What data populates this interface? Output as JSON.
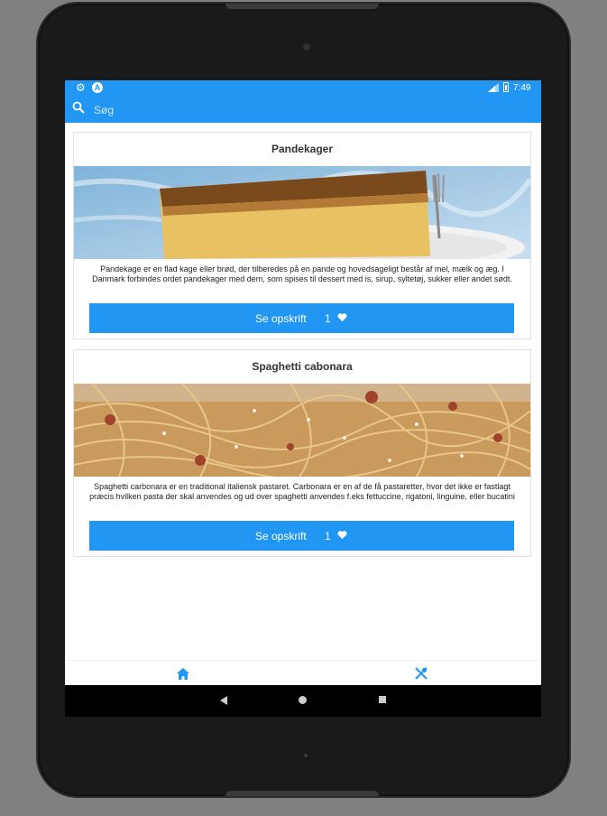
{
  "status_bar": {
    "time": "7:49"
  },
  "search": {
    "placeholder": "Søg",
    "value": ""
  },
  "recipes": [
    {
      "title": "Pandekager",
      "description": "Pandekage er en flad kage eller brød, der tilberedes på en pande og hovedsageligt består af mel, mælk og æg. I Danmark forbindes ordet pandekager med dem, som spises til dessert med is, sirup, syltetøj, sukker eller andet sødt.",
      "button_label": "Se opskrift",
      "likes": "1"
    },
    {
      "title": "Spaghetti cabonara",
      "description": "Spaghetti carbonara er en traditional italiensk pastaret. Carbonara er en af de få pastaretter, hvor det ikke er fastlagt præcis hvilken pasta der skal anvendes og ud over spaghetti anvendes f.eks fettuccine, rigatoni, linguine, eller bucatini",
      "button_label": "Se opskrift",
      "likes": "1"
    }
  ],
  "bottom_nav": [
    {
      "icon": "home-icon",
      "active": true
    },
    {
      "icon": "fork-knife-icon",
      "active": false
    }
  ],
  "colors": {
    "accent": "#2196f3"
  }
}
